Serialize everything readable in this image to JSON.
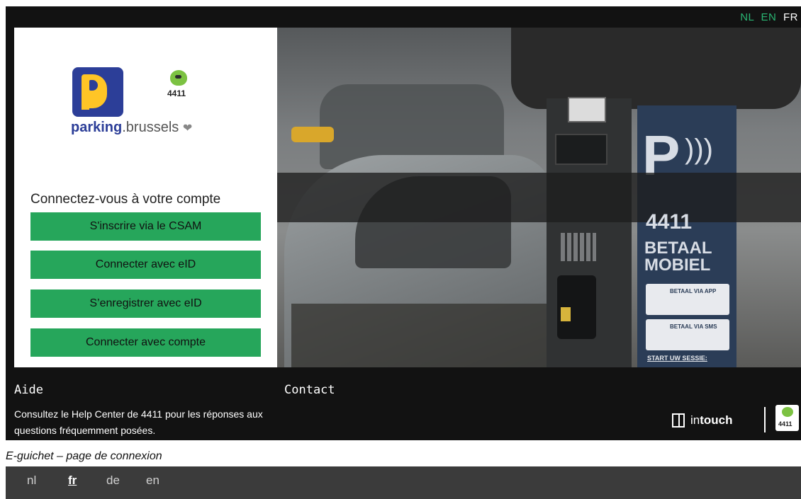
{
  "top_languages": [
    "NL",
    "EN",
    "FR"
  ],
  "brand": {
    "name_bold": "parking",
    "name_rest": ".brussels",
    "mascot_number": "4411"
  },
  "login": {
    "title": "Connectez-vous à votre compte",
    "buttons": [
      "S'inscrire via le CSAM",
      "Connecter avec eID",
      "S’enregistrer avec eID",
      "Connecter avec compte"
    ]
  },
  "photo_sign": {
    "number": "4411",
    "betaal_line1": "BETAAL",
    "betaal_line2": "MOBIEL",
    "card1": "BETAAL VIA APP",
    "card2": "BETAAL VIA SMS",
    "start": "START UW SESSIE:"
  },
  "footer": {
    "aide_title": "Aide",
    "contact_title": "Contact",
    "help_text": "Consultez le Help Center de 4411 pour les réponses aux questions fréquemment posées.",
    "intouch_light": "in",
    "intouch_bold": "touch",
    "mini_logo_number": "4411"
  },
  "caption": "E-guichet – page de connexion",
  "bottom_languages": [
    "nl",
    "fr",
    "de",
    "en"
  ],
  "colors": {
    "accent_green": "#26a65b",
    "brand_blue": "#2c3e98",
    "brand_yellow": "#ffc526"
  }
}
